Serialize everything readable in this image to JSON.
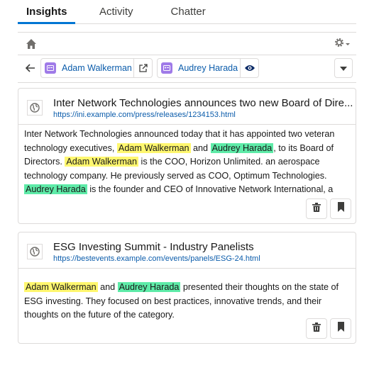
{
  "tabs": [
    {
      "label": "Insights",
      "active": true
    },
    {
      "label": "Activity",
      "active": false
    },
    {
      "label": "Chatter",
      "active": false
    }
  ],
  "toolbar": {
    "home_icon": "home-icon",
    "settings_icon": "gear-icon"
  },
  "contacts": [
    {
      "name": "Adam Walkerman",
      "action_icon": "external-link-icon"
    },
    {
      "name": "Audrey Harada",
      "action_icon": "eye-icon"
    }
  ],
  "articles": [
    {
      "title": "Inter Network Technologies announces two new Board of Dire...",
      "url": "https://ini.example.com/press/releases/1234153.html",
      "body": [
        {
          "text": "Inter Network Technologies announced today that it has appointed two veteran technology executives, "
        },
        {
          "text": "Adam Walkerman",
          "highlight": "a"
        },
        {
          "text": " and "
        },
        {
          "text": "Audrey Harada",
          "highlight": "b"
        },
        {
          "text": ", to its Board of Directors. "
        },
        {
          "text": "Adam Walkerman",
          "highlight": "a"
        },
        {
          "text": " is the COO, Horizon Unlimited. an aerospace technology company. He previously served as COO, Optimum Technologies. "
        },
        {
          "text": "Audrey Harada",
          "highlight": "b"
        },
        {
          "text": " is the founder and CEO of Innovative Network International, a"
        }
      ]
    },
    {
      "title": "ESG Investing Summit - Industry Panelists",
      "url": "https://bestevents.example.com/events/panels/ESG-24.html",
      "body": [
        {
          "text": "Adam Walkerman",
          "highlight": "a"
        },
        {
          "text": " and "
        },
        {
          "text": "Audrey Harada",
          "highlight": "b"
        },
        {
          "text": " presented their thoughts on the state of ESG investing. They focused on best practices, innovative trends, and their thoughts on the future of the category."
        }
      ]
    }
  ],
  "colors": {
    "accent": "#0176d3",
    "link": "#0b5cab",
    "highlight_a": "#fff76f",
    "highlight_b": "#5eeba8",
    "contact_icon": "#9f7ae8"
  }
}
